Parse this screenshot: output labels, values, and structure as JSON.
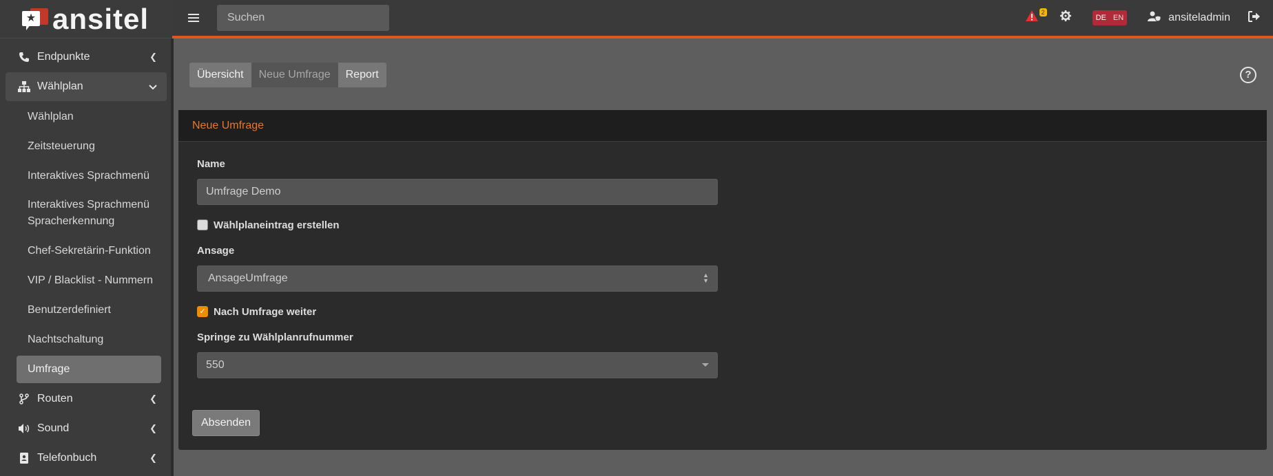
{
  "brand": {
    "name": "ansitel",
    "logo_icon": "star-chat-bubble-icon"
  },
  "topbar": {
    "search_placeholder": "Suchen",
    "alert_count": "2",
    "lang_de": "DE",
    "lang_en": "EN",
    "username": "ansiteladmin"
  },
  "sidebar": {
    "items": [
      {
        "label": "Endpunkte",
        "icon": "phone-icon"
      },
      {
        "label": "Wählplan",
        "icon": "sitemap-icon"
      },
      {
        "label": "Routen",
        "icon": "route-icon"
      },
      {
        "label": "Sound",
        "icon": "volume-icon"
      },
      {
        "label": "Telefonbuch",
        "icon": "address-book-icon"
      }
    ],
    "sub_items": [
      "Wählplan",
      "Zeitsteuerung",
      "Interaktives Sprachmenü",
      "Interaktives Sprachmenü Spracherkennung",
      "Chef-Sekretärin-Funktion",
      "VIP / Blacklist - Nummern",
      "Benutzerdefiniert",
      "Nachtschaltung",
      "Umfrage"
    ]
  },
  "tabs": [
    "Übersicht",
    "Neue Umfrage",
    "Report"
  ],
  "card": {
    "title": "Neue Umfrage",
    "name_label": "Name",
    "name_value": "Umfrage Demo",
    "checkbox1_label": "Wählplaneintrag erstellen",
    "checkbox1_checked": false,
    "ansage_label": "Ansage",
    "ansage_value": "AnsageUmfrage",
    "checkbox2_label": "Nach Umfrage weiter",
    "checkbox2_checked": true,
    "springe_label": "Springe zu Wählplanrufnummer",
    "springe_value": "550",
    "submit_label": "Absenden"
  },
  "colors": {
    "accent": "#e0571b",
    "card_title": "#e8772e",
    "checkbox_checked": "#f08c00",
    "lang_badge": "#b12a3a",
    "alert": "#e03131"
  }
}
